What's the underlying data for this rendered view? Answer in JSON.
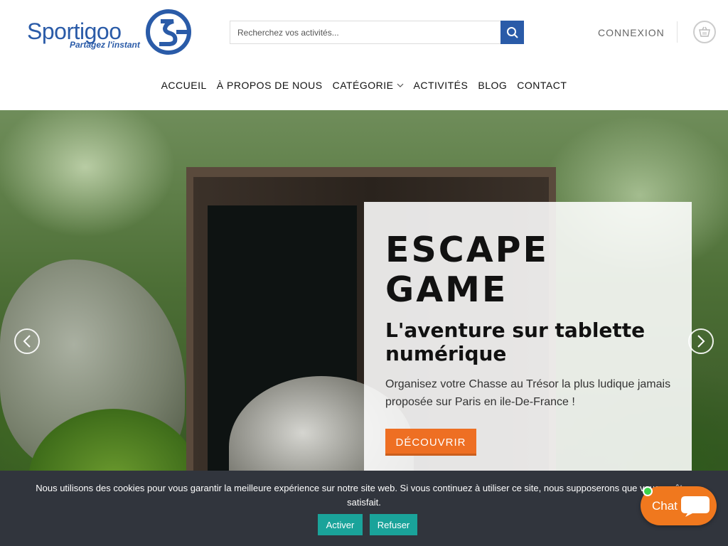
{
  "header": {
    "logo_text": "Sportigoo",
    "logo_tagline": "Partagez l'instant",
    "search_placeholder": "Recherchez vos activités...",
    "login_label": "CONNEXION"
  },
  "nav": {
    "items": [
      {
        "label": "ACCUEIL"
      },
      {
        "label": "À PROPOS DE NOUS"
      },
      {
        "label": "CATÉGORIE"
      },
      {
        "label": "ACTIVITÉS"
      },
      {
        "label": "BLOG"
      },
      {
        "label": "CONTACT"
      }
    ]
  },
  "hero": {
    "title": "ESCAPE GAME",
    "subtitle": "L'aventure sur tablette numérique",
    "description": "Organisez votre Chasse au Trésor la plus ludique jamais proposée sur Paris en ile-De-France !",
    "cta_label": "DÉCOUVRIR"
  },
  "cookie": {
    "text": "Nous utilisons des cookies pour vous garantir la meilleure expérience sur notre site web. Si vous continuez à utiliser ce site, nous supposerons que vous en êtes satisfait.",
    "accept_label": "Activer",
    "refuse_label": "Refuser"
  },
  "chat": {
    "label": "Chat"
  },
  "colors": {
    "brand_blue": "#2a5ba8",
    "cta_orange": "#ee6f23",
    "cookie_bg": "#31353d",
    "cookie_btn": "#1aa39a",
    "chat_orange": "#f0781e"
  }
}
